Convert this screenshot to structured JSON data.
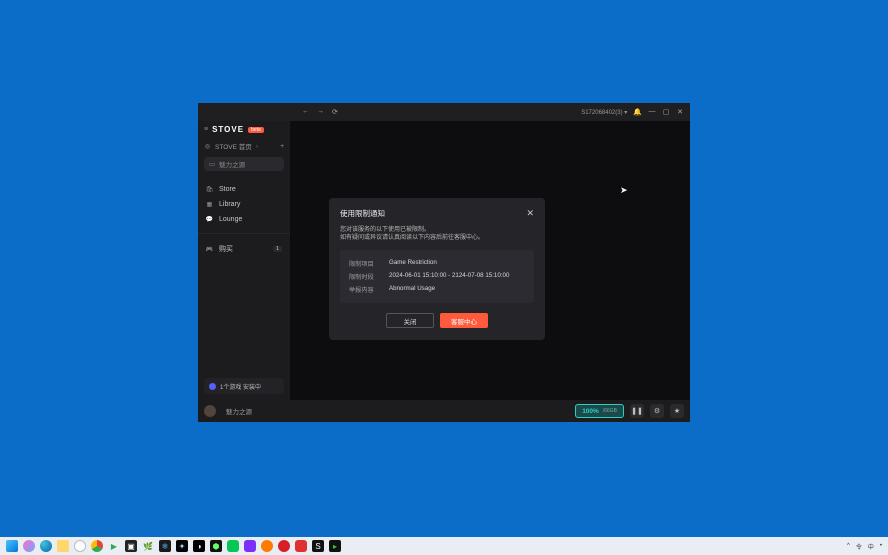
{
  "brand": {
    "name": "STOVE",
    "badge": "beta"
  },
  "sidebar": {
    "head": "STOVE 首页",
    "search_placeholder": "魅力之源",
    "items": [
      {
        "icon": "🛍",
        "label": "Store"
      },
      {
        "icon": "▦",
        "label": "Library"
      },
      {
        "icon": "💬",
        "label": "Lounge"
      }
    ],
    "purchased": {
      "icon": "🎮",
      "label": "购买",
      "count": "1"
    },
    "download_chip": "1个游戏 安装中"
  },
  "titlebar": {
    "user": "S172068402(3)",
    "nav_back": "←",
    "nav_fwd": "→",
    "nav_reload": "⟳",
    "bell": "🔔",
    "min": "—",
    "max": "▢",
    "close": "✕"
  },
  "modal": {
    "title": "使用限制通知",
    "desc_line1": "您对该服务的以下使用已被限制。",
    "desc_line2": "如有疑问或异议请认真阅读以下内容后前往客服中心。",
    "rows": [
      {
        "key": "限制项目",
        "val": "Game Restriction"
      },
      {
        "key": "限制时段",
        "val": "2024-06-01 15:10:00 - 2124-07-08 15:10:00"
      },
      {
        "key": "举报内容",
        "val": "Abnormal Usage"
      }
    ],
    "btn_close": "关闭",
    "btn_support": "客服中心"
  },
  "bottombar": {
    "game": "魅力之源",
    "pct": "100%",
    "sub": "/66GB"
  },
  "taskbar": {
    "time": "中",
    "lang": "令",
    "tray": "^"
  }
}
